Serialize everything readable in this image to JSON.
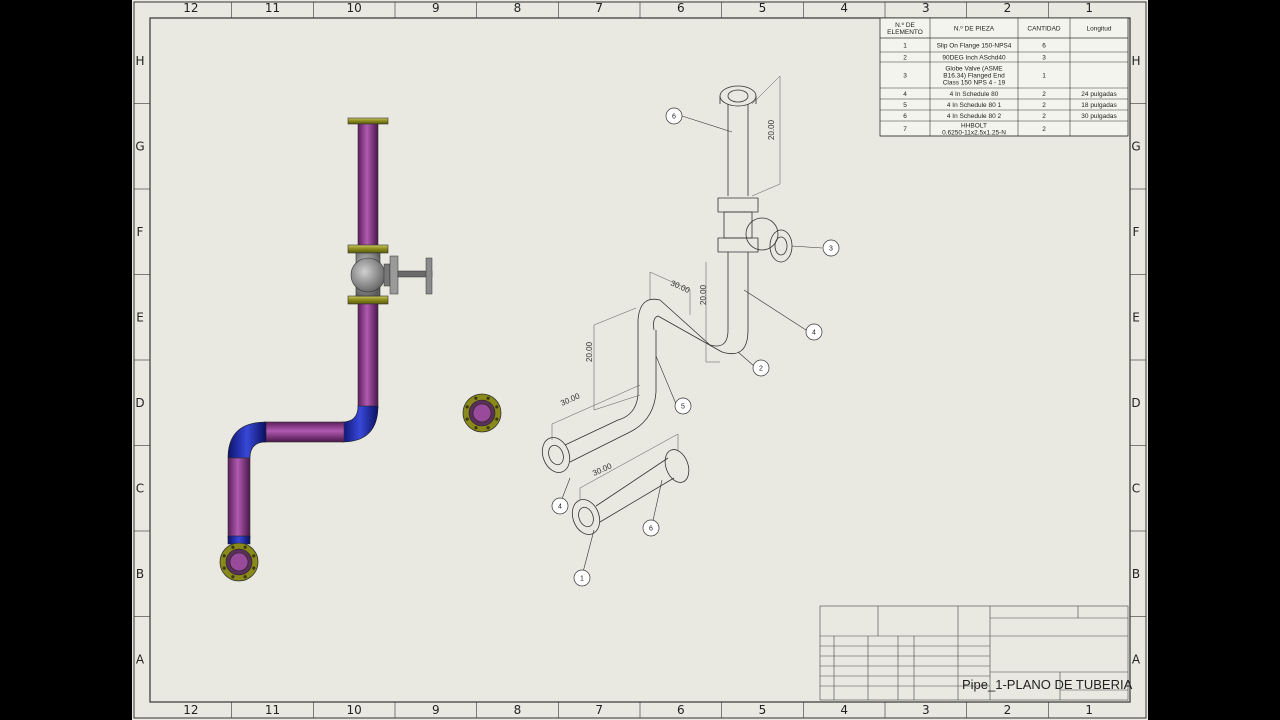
{
  "sheet": {
    "zone_columns": [
      "12",
      "11",
      "10",
      "9",
      "8",
      "7",
      "6",
      "5",
      "4",
      "3",
      "2",
      "1"
    ],
    "zone_rows": [
      "H",
      "G",
      "F",
      "E",
      "D",
      "C",
      "B",
      "A"
    ]
  },
  "bom": {
    "headers": [
      "N.º DE ELEMENTO",
      "N.º DE PIEZA",
      "CANTIDAD",
      "Longitud"
    ],
    "rows": [
      [
        "1",
        "Slip On Flange 150-NPS4",
        "6",
        ""
      ],
      [
        "2",
        "90DEG Inch ASchd40",
        "3",
        ""
      ],
      [
        "3",
        "Globe Valve (ASME B16.34) Flanged End Class 150 NPS 4 - 19",
        "1",
        ""
      ],
      [
        "4",
        "4 In Schedule 80",
        "2",
        "24 pulgadas"
      ],
      [
        "5",
        "4 In Schedule 80 1",
        "2",
        "18 pulgadas"
      ],
      [
        "6",
        "4 In Schedule 80 2",
        "2",
        "30 pulgadas"
      ],
      [
        "7",
        "HHBOLT 0.6250-11x2.5x1.25-N",
        "2",
        ""
      ]
    ]
  },
  "dimensions": [
    "20.00",
    "30.00",
    "20.00",
    "20.00",
    "30.00",
    "30.00"
  ],
  "balloons": [
    "6",
    "3",
    "4",
    "2",
    "5",
    "4",
    "6",
    "1"
  ],
  "title_block": {
    "drawing_title": "Pipe_1-PLANO DE TUBERIA"
  },
  "colors": {
    "pipe_purple": "#8e3c8e",
    "elbow_blue": "#1f2bb0",
    "flange_olive": "#8a8a1a",
    "valve_gray": "#8c8c8c",
    "sheet_bg": "#e9e9e1"
  }
}
